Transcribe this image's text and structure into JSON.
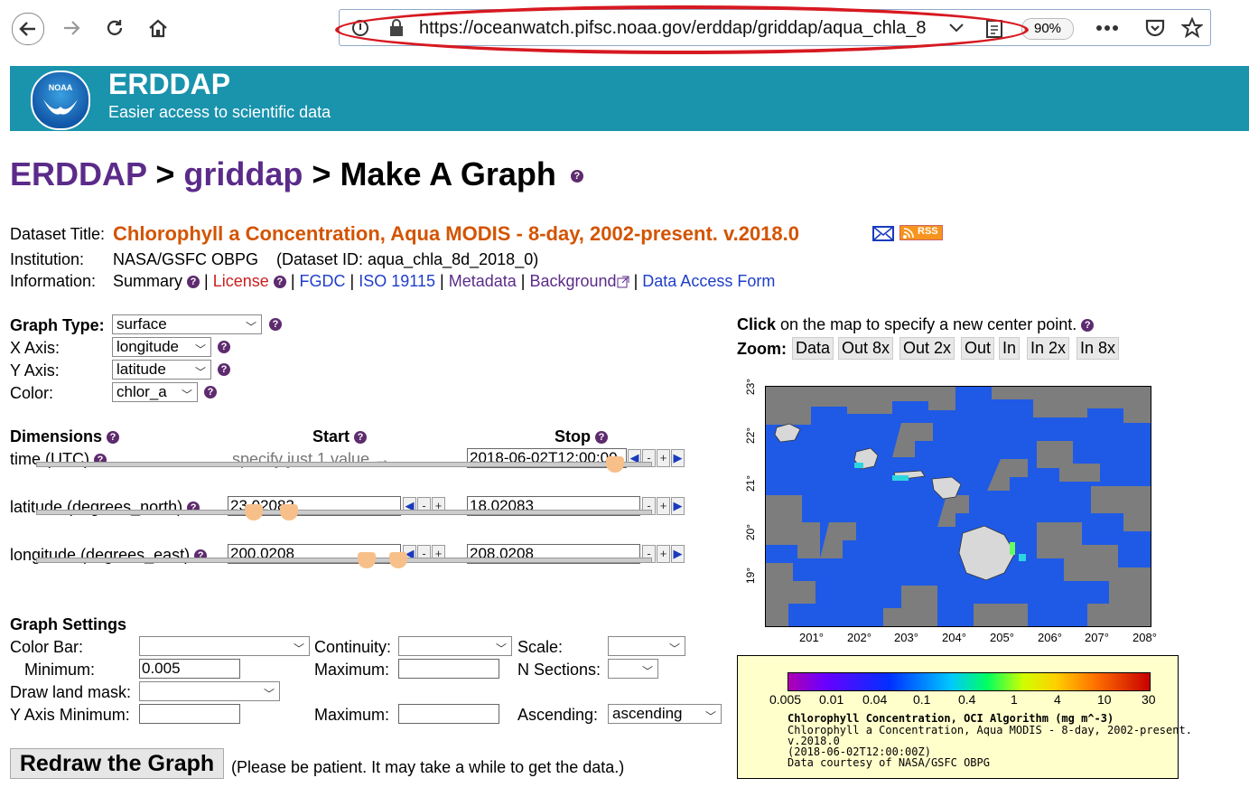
{
  "browser": {
    "url": "https://oceanwatch.pifsc.noaa.gov/erddap/griddap/aqua_chla_8",
    "zoom": "90%",
    "icons": [
      "back-icon",
      "forward-icon",
      "reload-icon",
      "home-icon",
      "info-icon",
      "lock-icon",
      "chevron-down-icon",
      "reader-icon",
      "more-icon",
      "pocket-icon",
      "star-icon"
    ]
  },
  "banner": {
    "title": "ERDDAP",
    "subtitle": "Easier access to scientific data",
    "logo_text": "NOAA"
  },
  "breadcrumb": {
    "part1": "ERDDAP",
    "sep1": " > ",
    "part2": "griddap",
    "sep2": " > ",
    "part3": "Make A Graph"
  },
  "dataset": {
    "title_label": "Dataset Title:",
    "title": "Chlorophyll a Concentration, Aqua MODIS - 8-day, 2002-present. v.2018.0",
    "rss": "RSS",
    "institution_label": "Institution:",
    "institution": "NASA/GSFC OBPG",
    "dataset_id": "(Dataset ID: aqua_chla_8d_2018_0)",
    "information_label": "Information:",
    "links": {
      "summary": "Summary",
      "license": "License",
      "fgdc": "FGDC",
      "iso": "ISO 19115",
      "metadata": "Metadata",
      "background": "Background",
      "access_form": "Data Access Form"
    }
  },
  "graph": {
    "type_label": "Graph Type:",
    "type_value": "surface",
    "x_label": "X Axis:",
    "x_value": "longitude",
    "y_label": "Y Axis:",
    "y_value": "latitude",
    "color_label": "Color:",
    "color_value": "chlor_a"
  },
  "dimensions": {
    "header": "Dimensions",
    "start_header": "Start",
    "stop_header": "Stop",
    "time_label": "time (UTC)",
    "time_hint": "specify just 1 value →",
    "time_stop": "2018-06-02T12:00:00",
    "lat_label": "latitude (degrees_north)",
    "lat_start": "23.02083",
    "lat_stop": "18.02083",
    "lon_label": "longitude (degrees_east)",
    "lon_start": "200.0208",
    "lon_stop": "208.0208"
  },
  "settings": {
    "header": "Graph Settings",
    "color_bar_label": "Color Bar:",
    "continuity_label": "Continuity:",
    "scale_label": "Scale:",
    "minimum_label": "Minimum:",
    "minimum_value": "0.005",
    "maximum_label": "Maximum:",
    "nsections_label": "N Sections:",
    "land_mask_label": "Draw land mask:",
    "y_min_label": "Y Axis Minimum:",
    "y_max_label": "Maximum:",
    "ascending_label": "Ascending:",
    "ascending_value": "ascending"
  },
  "redraw": {
    "button": "Redraw the Graph",
    "note": "(Please be patient. It may take a while to get the data.)"
  },
  "map_panel": {
    "click_bold": "Click",
    "click_rest": " on the map to specify a new center point.",
    "zoom_label": "Zoom:",
    "zoom_buttons": [
      "Data",
      "Out 8x",
      "Out 2x",
      "Out",
      "In",
      "In 2x",
      "In 8x"
    ],
    "y_ticks": [
      "23°",
      "22°",
      "21°",
      "20°",
      "19°"
    ],
    "x_ticks": [
      "201°",
      "202°",
      "203°",
      "204°",
      "205°",
      "206°",
      "207°",
      "208°"
    ]
  },
  "legend": {
    "ticks": [
      "0.005",
      "0.01",
      "0.04",
      "0.1",
      "0.4",
      "1",
      "4",
      "10",
      "30"
    ],
    "title": "Chlorophyll Concentration, OCI Algorithm (mg m^-3)",
    "line1": "Chlorophyll a Concentration, Aqua MODIS - 8-day, 2002-present.",
    "line2": "v.2018.0",
    "line3": "(2018-06-02T12:00:00Z)",
    "line4": "Data courtesy of NASA/GSFC OBPG"
  }
}
